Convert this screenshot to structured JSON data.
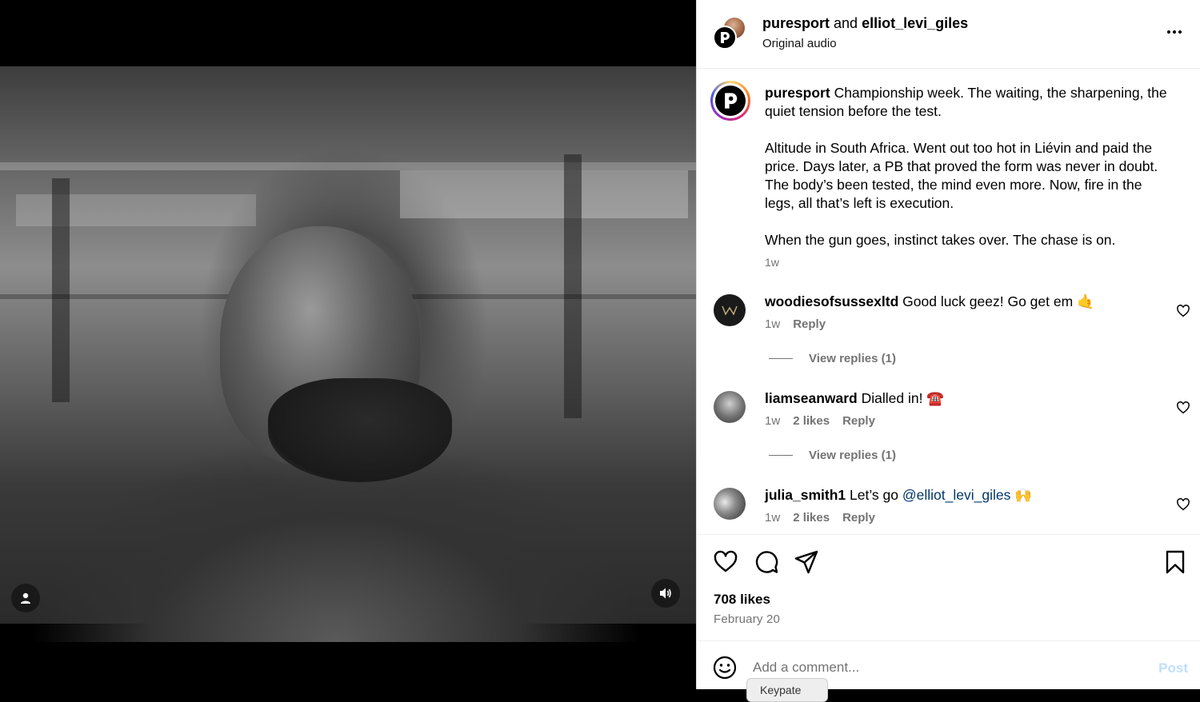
{
  "header": {
    "author": "puresport",
    "conjunction": "and",
    "collaborator": "elliot_levi_giles",
    "audio": "Original audio"
  },
  "caption": {
    "username": "puresport",
    "paragraph1": "Championship week. The waiting, the sharpening, the quiet tension before the test.",
    "paragraph2": "Altitude in South Africa. Went out too hot in Liévin and paid the price. Days later, a PB that proved the form was never in doubt. The body’s been tested, the mind even more. Now, fire in the legs, all that’s left is execution.",
    "paragraph3": "When the gun goes, instinct takes over. The chase is on.",
    "time": "1w"
  },
  "comments": [
    {
      "username": "woodiesofsussexltd",
      "text": "Good luck geez! Go get em 🤙",
      "time": "1w",
      "likes": "",
      "reply": "Reply",
      "view_replies": "View replies (1)"
    },
    {
      "username": "liamseanward",
      "text": "Dialled in! ☎️",
      "time": "1w",
      "likes": "2 likes",
      "reply": "Reply",
      "view_replies": "View replies (1)"
    },
    {
      "username": "julia_smith1",
      "text_before": "Let’s go ",
      "mention": "@elliot_levi_giles",
      "text_after": " 🙌",
      "time": "1w",
      "likes": "2 likes",
      "reply": "Reply"
    }
  ],
  "stats": {
    "likes": "708 likes",
    "date": "February 20"
  },
  "composer": {
    "placeholder": "Add a comment...",
    "post_label": "Post",
    "tooltip": "Keypate"
  },
  "icons": {
    "like": "heart-icon",
    "comment": "comment-icon",
    "share": "paper-plane-icon",
    "save": "bookmark-icon",
    "emoji": "smiley-icon",
    "more": "more-icon",
    "sound": "speaker-icon",
    "tags": "user-tag-icon"
  },
  "colors": {
    "link": "#00376b",
    "muted": "#737373",
    "post_disabled": "#c0dffd"
  }
}
